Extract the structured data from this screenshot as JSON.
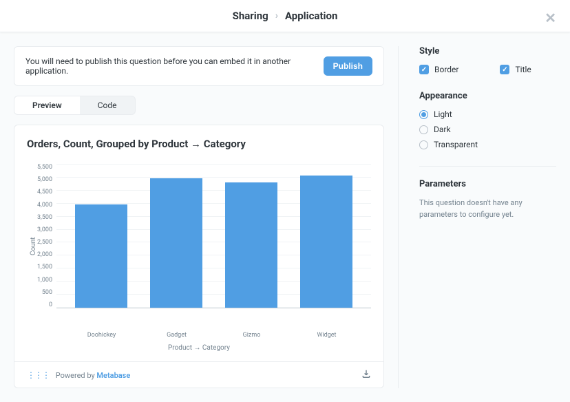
{
  "header": {
    "crumb1": "Sharing",
    "crumb2": "Application"
  },
  "publish_bar": {
    "message": "You will need to publish this question before you can embed it in another application.",
    "button": "Publish"
  },
  "tabs": {
    "preview": "Preview",
    "code": "Code"
  },
  "chart_data": {
    "type": "bar",
    "title": "Orders, Count, Grouped by Product → Category",
    "xlabel": "Product → Category",
    "ylabel": "Count",
    "ymax": 5500,
    "yticks": [
      "5,500",
      "5,000",
      "4,500",
      "4,000",
      "3,500",
      "3,000",
      "2,500",
      "2,000",
      "1,500",
      "1,000",
      "500",
      "0"
    ],
    "categories": [
      "Doohickey",
      "Gadget",
      "Gizmo",
      "Widget"
    ],
    "values": [
      3950,
      4950,
      4780,
      5050
    ]
  },
  "footer": {
    "powered_by": "Powered by ",
    "brand": "Metabase"
  },
  "style_panel": {
    "title": "Style",
    "border_label": "Border",
    "title_label": "Title",
    "appearance_title": "Appearance",
    "options": {
      "light": "Light",
      "dark": "Dark",
      "transparent": "Transparent"
    },
    "params_title": "Parameters",
    "params_text": "This question doesn't have any parameters to configure yet."
  }
}
